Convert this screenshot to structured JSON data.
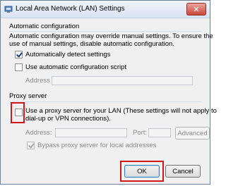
{
  "window": {
    "title": "Local Area Network (LAN) Settings",
    "close_label": "✕"
  },
  "automatic_configuration": {
    "group_label": "Automatic configuration",
    "description": "Automatic configuration may override manual settings.  To ensure the use of manual settings, disable automatic configuration.",
    "description_line1": "Automatic configuration may override manual settings.  To ensure the",
    "description_line2": "use of manual settings, disable automatic configuration.",
    "auto_detect": {
      "label": "Automatically detect settings",
      "checked": true
    },
    "use_script": {
      "label": "Use automatic configuration script",
      "checked": false
    },
    "address_label": "Address",
    "address_value": ""
  },
  "proxy_server": {
    "group_label": "Proxy server",
    "use_proxy": {
      "label_line1": "Use a proxy server for your LAN (These settings will not apply to",
      "label_line2": "dial-up or VPN connections).",
      "checked": false
    },
    "address_label": "Address:",
    "address_value": "",
    "port_label": "Port:",
    "port_value": "",
    "advanced_label": "Advanced",
    "bypass_local": {
      "label": "Bypass proxy server for local addresses",
      "checked": true
    }
  },
  "buttons": {
    "ok_label": "OK",
    "cancel_label": "Cancel"
  },
  "colors": {
    "highlight": "#d01818",
    "window_border": "#6e7f96",
    "dialog_bg": "#f0f0f0"
  }
}
